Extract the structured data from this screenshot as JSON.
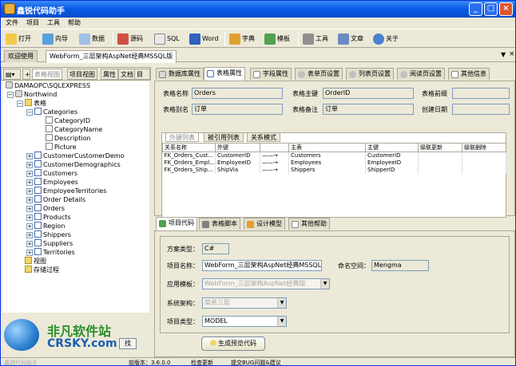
{
  "window": {
    "title": "鑫锐代码助手"
  },
  "menu": [
    "文件",
    "项目",
    "工具",
    "帮助"
  ],
  "toolbar": [
    {
      "label": "打开",
      "icon": "folder-open-icon"
    },
    {
      "label": "向导",
      "icon": "wizard-icon"
    },
    {
      "label": "数据",
      "icon": "database-icon"
    },
    {
      "label": "源码",
      "icon": "source-code-icon"
    },
    {
      "label": "SQL",
      "icon": "sql-icon"
    },
    {
      "label": "Word",
      "icon": "word-icon"
    },
    {
      "label": "字典",
      "icon": "dictionary-icon"
    },
    {
      "label": "模板",
      "icon": "template-icon"
    },
    {
      "label": "工具",
      "icon": "tools-icon"
    },
    {
      "label": "文章",
      "icon": "article-icon"
    },
    {
      "label": "关于",
      "icon": "about-icon"
    }
  ],
  "doc_tabs": [
    {
      "label": "欢迎使用"
    },
    {
      "label": "WebForm_三层架构AspNet经典MSSQL版"
    }
  ],
  "left_tabs": [
    "表格视图",
    "项目视图",
    "属性",
    "文档",
    "目录"
  ],
  "tree": {
    "server": "DAMAOPC\\SQLEXPRESS",
    "database": "Northwind",
    "tables_folder": "表格",
    "expanded_table": "Categories",
    "columns": [
      "CategoryID",
      "CategoryName",
      "Description",
      "Picture"
    ],
    "tables": [
      "CustomerCustomerDemo",
      "CustomerDemographics",
      "Customers",
      "Employees",
      "EmployeeTerritories",
      "Order Details",
      "Orders",
      "Products",
      "Region",
      "Shippers",
      "Suppliers",
      "Territories"
    ],
    "views_folder": "视图",
    "procs_folder": "存储过程"
  },
  "right_tabs": [
    "数据库属性",
    "表格属性",
    "字段属性",
    "表单页设置",
    "列表页设置",
    "阅读页设置",
    "其他信息"
  ],
  "table_props": {
    "name_label": "表格名称",
    "name_value": "Orders",
    "pk_label": "表格主键",
    "pk_value": "OrderID",
    "prefix_label": "表格前缀",
    "prefix_value": "",
    "alias_label": "表格别名",
    "alias_value": "订单",
    "remark_label": "表格备注",
    "remark_value": "订单",
    "created_label": "创建日期",
    "created_value": ""
  },
  "fk_tabs": [
    "外键列表",
    "被引用列表",
    "关系模式"
  ],
  "fk_table": {
    "headers": [
      "关系名称",
      "外键",
      "",
      "主表",
      "主键",
      "级联更新",
      "级联删除"
    ],
    "rows": [
      [
        "FK_Orders_Cust...",
        "CustomerID",
        "——→",
        "Customers",
        "CustomerID",
        "",
        ""
      ],
      [
        "FK_Orders_Empl...",
        "EmployeeID",
        "——→",
        "Employees",
        "EmployeeID",
        "",
        ""
      ],
      [
        "FK_Orders_Ship...",
        "ShipVia",
        "——→",
        "Shippers",
        "ShipperID",
        "",
        ""
      ]
    ]
  },
  "bottom_tabs": [
    "项目代码",
    "表格脚本",
    "设计模型",
    "其他帮助"
  ],
  "code": {
    "scheme_label": "方案类型：",
    "scheme_value": "C#",
    "project_label": "项目名称：",
    "project_value": "WebForm_三层架构AspNet经典MSSQL版",
    "ns_label": "命名空间：",
    "ns_value": "Mengma",
    "template_label": "应用模板：",
    "template_value": "WebForm_三层架构AspNet经典版",
    "arch_label": "系统架构：",
    "arch_value": "简单三层",
    "type_label": "项目类型：",
    "type_value": "MODEL",
    "generate_label": "生成预览代码"
  },
  "status": {
    "version": "前版本：3.6.0.0",
    "check": "检查更新",
    "bug": "提交BUG问题&建议",
    "left": "鑫锐代码助手"
  },
  "watermark": {
    "line1": "非凡软件站",
    "line2": "CRSKY.com"
  },
  "colors": {
    "title_bar": "#0a5ce6",
    "panel_bg": "#ece9d8",
    "border": "#aca899"
  }
}
